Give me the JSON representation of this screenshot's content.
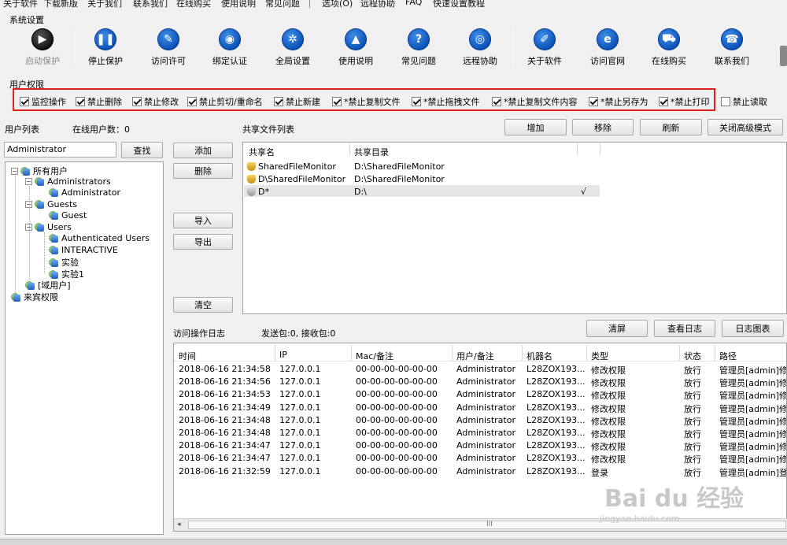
{
  "menu": [
    "关于软件",
    "下载新版",
    "关于我们",
    "联系我们",
    "在线购买",
    "使用说明",
    "常见问题",
    "选项(O)",
    "远程协助",
    "FAQ",
    "快速设置教程"
  ],
  "system_settings": {
    "title": "系统设置",
    "buttons": [
      {
        "label": "启动保护",
        "icon": "play-icon",
        "glyph": "▶",
        "disabled": true
      },
      {
        "label": "停止保护",
        "icon": "pause-icon",
        "glyph": "❚❚",
        "disabled": false
      },
      {
        "label": "访问许可",
        "icon": "key-icon",
        "glyph": "✎",
        "disabled": false
      },
      {
        "label": "绑定认证",
        "icon": "globe-icon",
        "glyph": "◉",
        "disabled": false
      },
      {
        "label": "全局设置",
        "icon": "gear-icon",
        "glyph": "✲",
        "disabled": false
      },
      {
        "label": "使用说明",
        "icon": "graduation-cap-icon",
        "glyph": "▲",
        "disabled": false
      },
      {
        "label": "常见问题",
        "icon": "question-icon",
        "glyph": "?",
        "disabled": false
      },
      {
        "label": "远程协助",
        "icon": "network-icon",
        "glyph": "◎",
        "disabled": false
      },
      {
        "label": "关于软件",
        "icon": "edit-icon",
        "glyph": "✐",
        "disabled": false
      },
      {
        "label": "访问官网",
        "icon": "browser-icon",
        "glyph": "e",
        "disabled": false
      },
      {
        "label": "在线购买",
        "icon": "cart-icon",
        "glyph": "⛟",
        "disabled": false
      },
      {
        "label": "联系我们",
        "icon": "phone-icon",
        "glyph": "☎",
        "disabled": false
      }
    ]
  },
  "permissions": {
    "title": "用户权限",
    "items": [
      {
        "label": "监控操作",
        "checked": true
      },
      {
        "label": "禁止删除",
        "checked": true
      },
      {
        "label": "禁止修改",
        "checked": true
      },
      {
        "label": "禁止剪切/重命名",
        "checked": true
      },
      {
        "label": "禁止新建",
        "checked": true
      },
      {
        "label": "*禁止复制文件",
        "checked": true
      },
      {
        "label": "*禁止拖拽文件",
        "checked": true
      },
      {
        "label": "*禁止复制文件内容",
        "checked": true
      },
      {
        "label": "*禁止另存为",
        "checked": true
      },
      {
        "label": "*禁止打印",
        "checked": true
      },
      {
        "label": "禁止读取",
        "checked": false
      }
    ]
  },
  "users": {
    "list_label": "用户列表",
    "online_label": "在线用户数：",
    "online_count": "0",
    "search_value": "Administrator",
    "search_button": "查找",
    "tree": [
      {
        "label": "所有用户",
        "level": 0,
        "expander": "−"
      },
      {
        "label": "Administrators",
        "level": 1,
        "expander": "−"
      },
      {
        "label": "Administrator",
        "level": 2,
        "expander": ""
      },
      {
        "label": "Guests",
        "level": 1,
        "expander": "−"
      },
      {
        "label": "Guest",
        "level": 2,
        "expander": ""
      },
      {
        "label": "Users",
        "level": 1,
        "expander": "−"
      },
      {
        "label": "Authenticated Users",
        "level": 2,
        "expander": ""
      },
      {
        "label": "INTERACTIVE",
        "level": 2,
        "expander": ""
      },
      {
        "label": "实验",
        "level": 2,
        "expander": ""
      },
      {
        "label": "实验1",
        "level": 2,
        "expander": ""
      },
      {
        "label": "[域用户]",
        "level": 1,
        "expander": ""
      },
      {
        "label": "来宾权限",
        "level": 0,
        "expander": ""
      }
    ]
  },
  "middle_buttons": {
    "add": "添加",
    "delete": "删除",
    "import": "导入",
    "export": "导出",
    "clear": "清空"
  },
  "shares": {
    "title": "共享文件列表",
    "buttons": {
      "add": "增加",
      "remove": "移除",
      "refresh": "刷新",
      "close_advanced": "关闭高级模式"
    },
    "columns": [
      "共享名",
      "共享目录"
    ],
    "rows": [
      {
        "name": "SharedFileMonitor",
        "dir": "D:\\SharedFileMonitor",
        "flag": ""
      },
      {
        "name": "D\\SharedFileMonitor",
        "dir": "D:\\SharedFileMonitor",
        "flag": ""
      },
      {
        "name": "D*",
        "dir": "D:\\",
        "flag": "√"
      }
    ]
  },
  "log": {
    "title": "访问操作日志",
    "packets": "发送包:0, 接收包:0",
    "buttons": {
      "clear": "清屏",
      "view": "查看日志",
      "chart": "日志图表"
    },
    "columns": [
      "时间",
      "IP",
      "Mac/备注",
      "用户/备注",
      "机器名",
      "类型",
      "状态",
      "路径"
    ],
    "rows": [
      [
        "2018-06-16 21:34:58",
        "127.0.0.1",
        "00-00-00-00-00-00",
        "Administrator",
        "L28ZOX193...",
        "修改权限",
        "放行",
        "管理员[admin]修改"
      ],
      [
        "2018-06-16 21:34:56",
        "127.0.0.1",
        "00-00-00-00-00-00",
        "Administrator",
        "L28ZOX193...",
        "修改权限",
        "放行",
        "管理员[admin]修改"
      ],
      [
        "2018-06-16 21:34:53",
        "127.0.0.1",
        "00-00-00-00-00-00",
        "Administrator",
        "L28ZOX193...",
        "修改权限",
        "放行",
        "管理员[admin]修改"
      ],
      [
        "2018-06-16 21:34:49",
        "127.0.0.1",
        "00-00-00-00-00-00",
        "Administrator",
        "L28ZOX193...",
        "修改权限",
        "放行",
        "管理员[admin]修改"
      ],
      [
        "2018-06-16 21:34:48",
        "127.0.0.1",
        "00-00-00-00-00-00",
        "Administrator",
        "L28ZOX193...",
        "修改权限",
        "放行",
        "管理员[admin]修改"
      ],
      [
        "2018-06-16 21:34:48",
        "127.0.0.1",
        "00-00-00-00-00-00",
        "Administrator",
        "L28ZOX193...",
        "修改权限",
        "放行",
        "管理员[admin]修改"
      ],
      [
        "2018-06-16 21:34:47",
        "127.0.0.1",
        "00-00-00-00-00-00",
        "Administrator",
        "L28ZOX193...",
        "修改权限",
        "放行",
        "管理员[admin]修改"
      ],
      [
        "2018-06-16 21:34:47",
        "127.0.0.1",
        "00-00-00-00-00-00",
        "Administrator",
        "L28ZOX193...",
        "修改权限",
        "放行",
        "管理员[admin]修改"
      ],
      [
        "2018-06-16 21:32:59",
        "127.0.0.1",
        "00-00-00-00-00-00",
        "Administrator",
        "L28ZOX193...",
        "登录",
        "放行",
        "管理员[admin]登录"
      ]
    ]
  },
  "watermark": {
    "main": "Bai du 经验",
    "sub": "jingyan.baidu.com"
  },
  "scrollbar_grip": "III"
}
